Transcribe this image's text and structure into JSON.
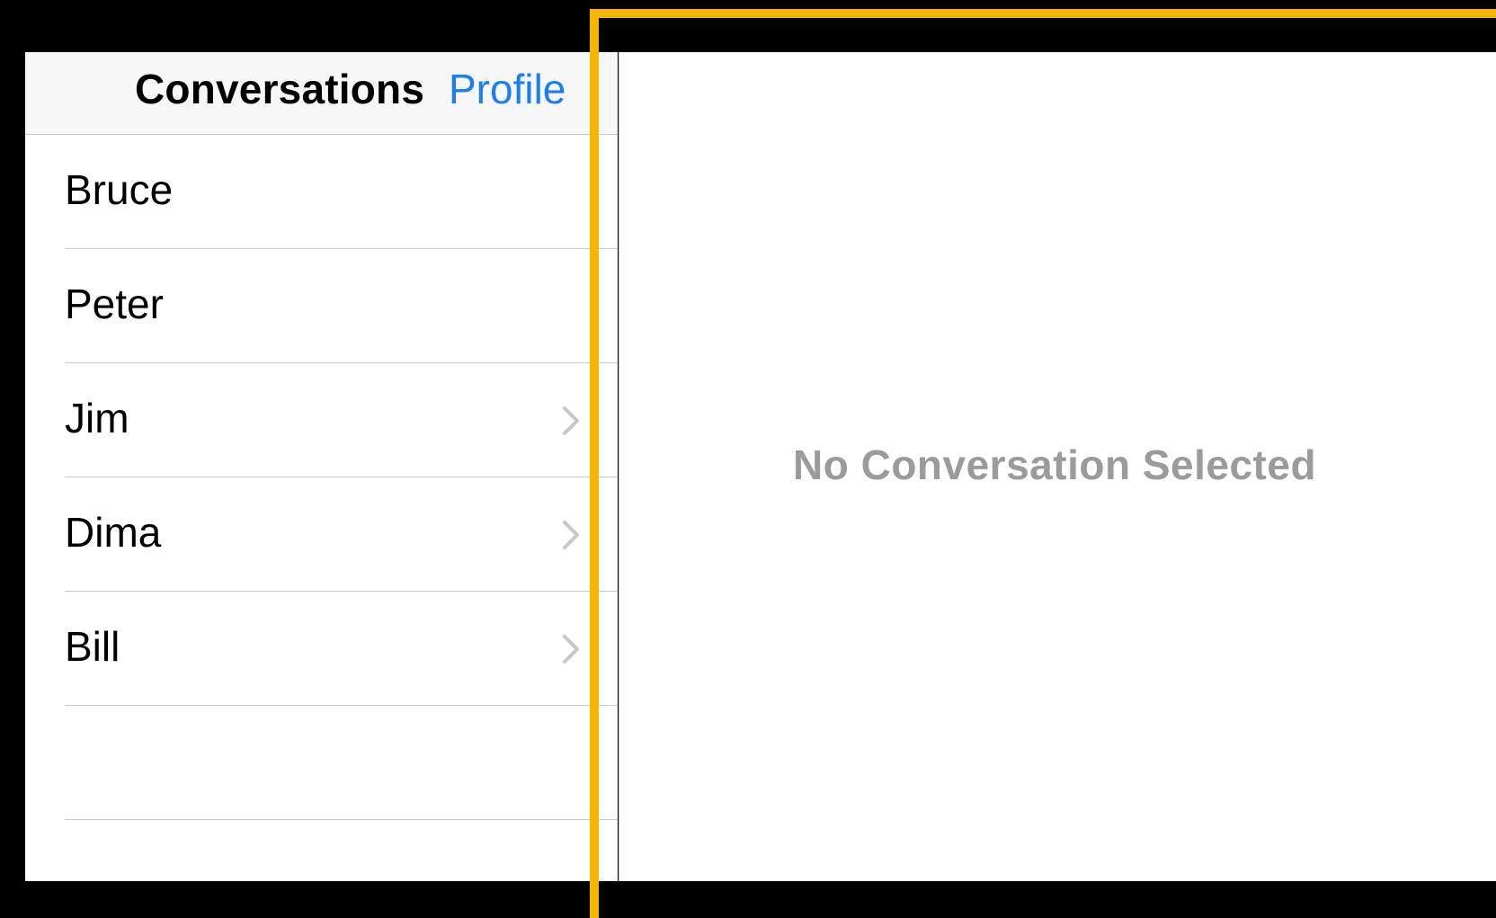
{
  "master": {
    "title": "Conversations",
    "profile_button": "Profile",
    "conversations": [
      {
        "name": "Bruce",
        "has_chevron": false
      },
      {
        "name": "Peter",
        "has_chevron": false
      },
      {
        "name": "Jim",
        "has_chevron": true
      },
      {
        "name": "Dima",
        "has_chevron": true
      },
      {
        "name": "Bill",
        "has_chevron": true
      }
    ],
    "chevron_icon": "chevron-right-icon"
  },
  "detail": {
    "empty_message": "No Conversation Selected"
  },
  "colors": {
    "accent": "#1a7ef5",
    "highlight_frame": "#f7b500",
    "placeholder_text": "#9b9b9b",
    "separator": "#c8c7cc"
  }
}
